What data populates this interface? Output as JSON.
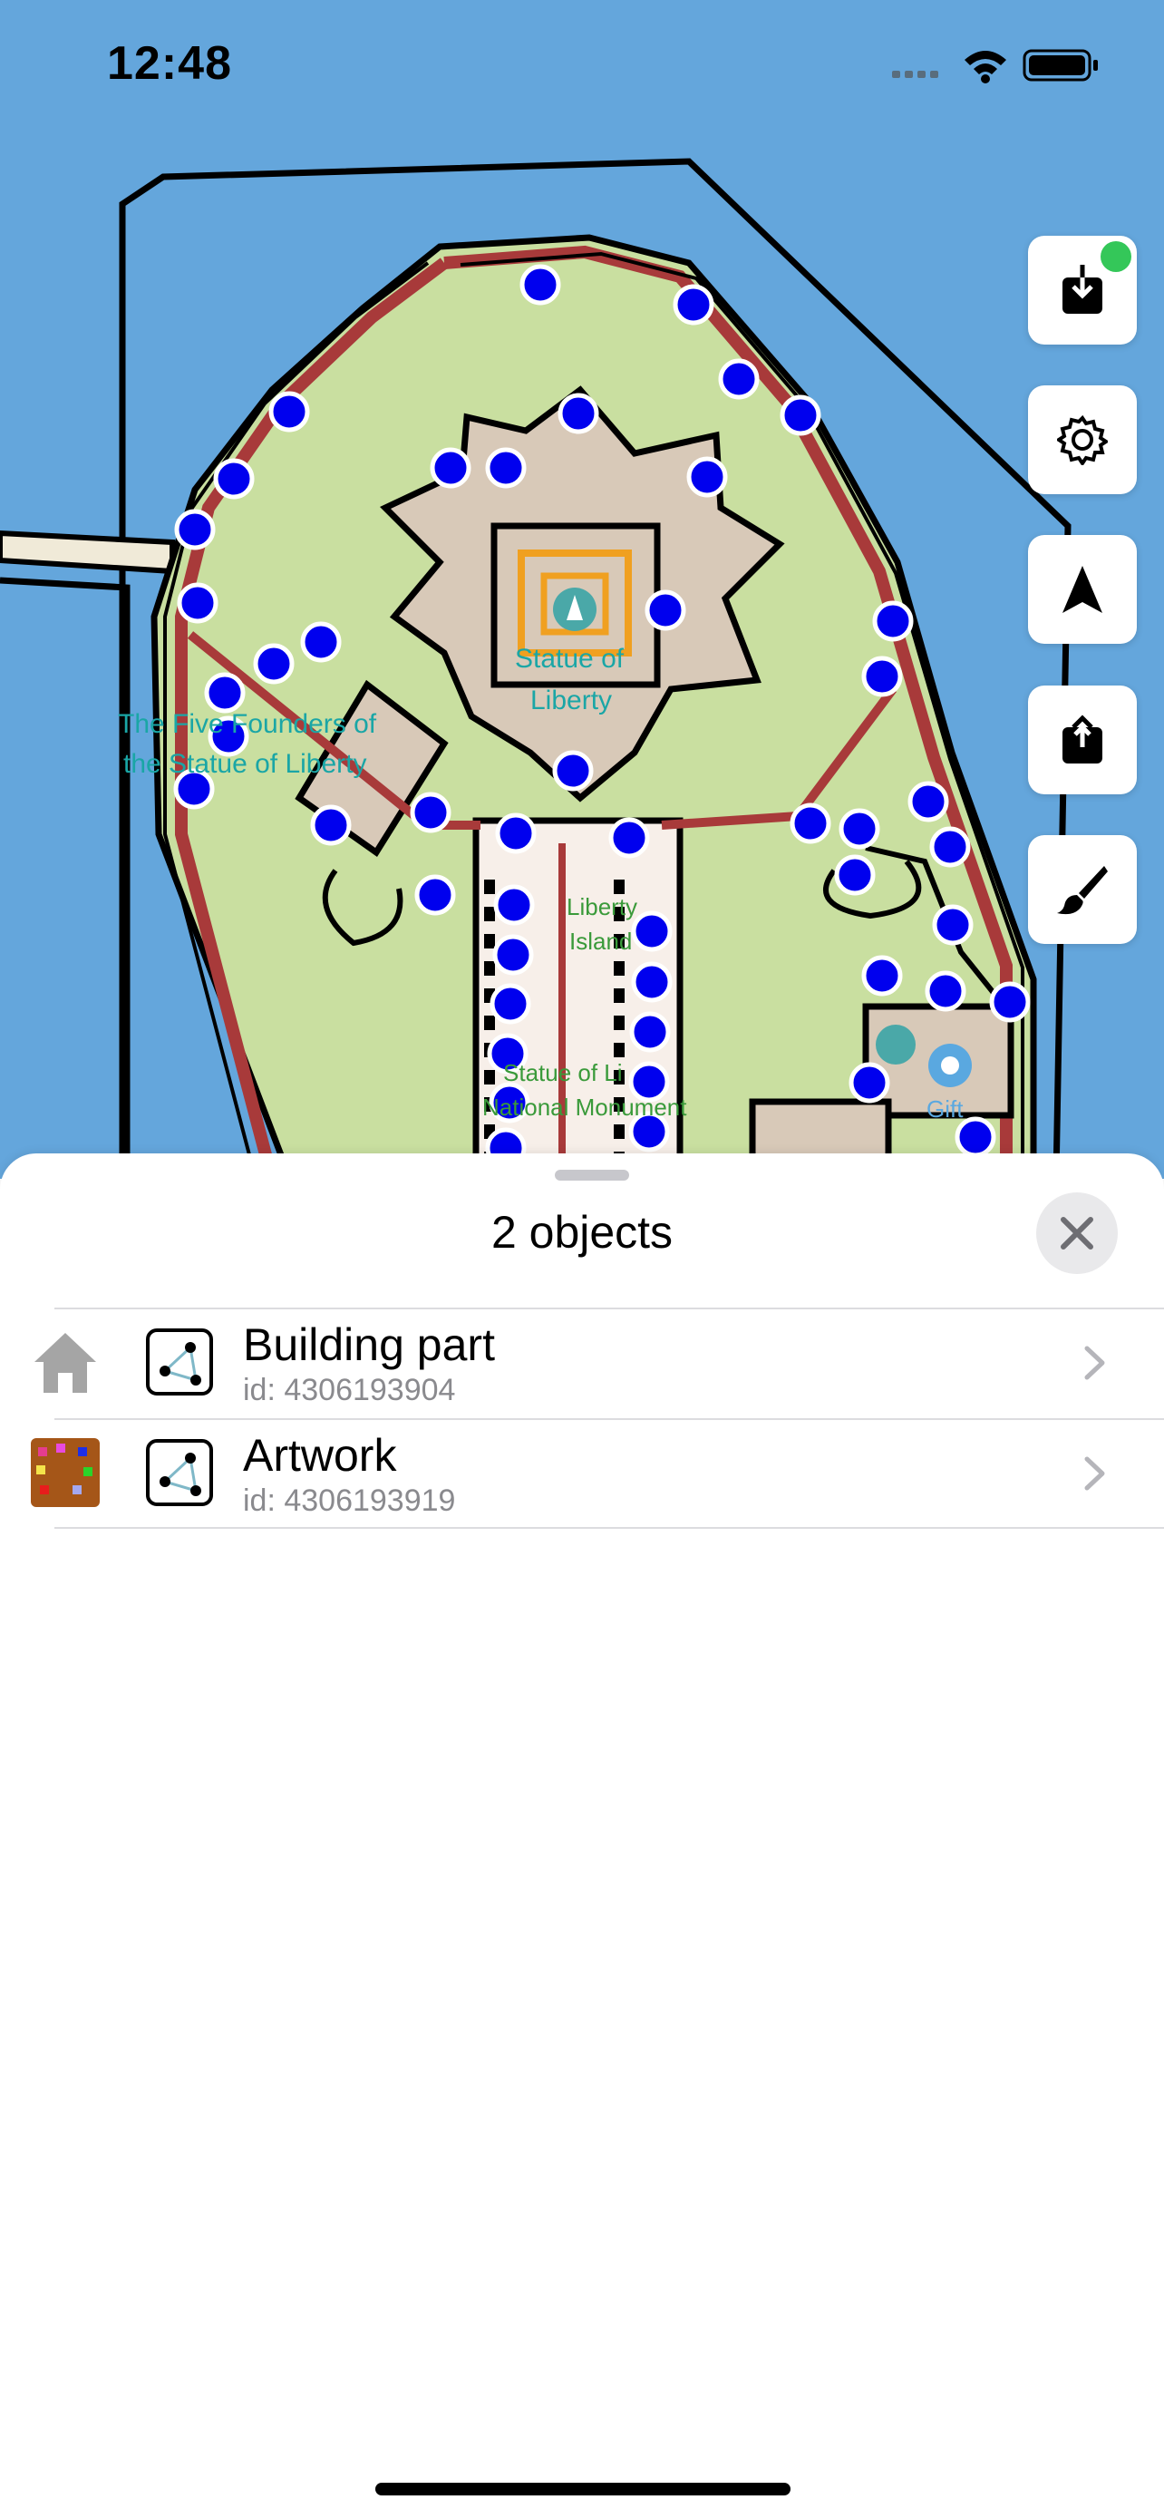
{
  "status_bar": {
    "time": "12:48",
    "icons": [
      "cellular-icon",
      "wifi-icon",
      "battery-icon"
    ]
  },
  "map": {
    "labels": [
      {
        "text": "Statue of"
      },
      {
        "text": "Liberty"
      },
      {
        "text": "The Five Founders of"
      },
      {
        "text": "the Statue of Liberty"
      },
      {
        "text": "Liberty"
      },
      {
        "text": "Island"
      },
      {
        "text": "Statue of Li"
      },
      {
        "text": "National Monument"
      },
      {
        "text": "Gift"
      }
    ],
    "colors": {
      "water": "#64a6dc",
      "grass": "#c9dfa0",
      "pavement": "#d8c9b8",
      "road_red": "#a83a3a",
      "node_blue": "#0000ee",
      "label_teal": "#1aa6a6",
      "label_green": "#3a9a3a"
    }
  },
  "toolbar": {
    "buttons": [
      {
        "name": "download-button",
        "icon": "download-icon",
        "has_badge": true
      },
      {
        "name": "settings-button",
        "icon": "gear-icon"
      },
      {
        "name": "location-button",
        "icon": "location-arrow-icon"
      },
      {
        "name": "upload-button",
        "icon": "upload-icon"
      },
      {
        "name": "paint-button",
        "icon": "brush-icon"
      }
    ],
    "badge_color": "#34c759"
  },
  "sheet": {
    "title": "2 objects",
    "close_icon": "close-icon",
    "items": [
      {
        "title": "Building part",
        "subtitle": "id: 4306193904",
        "icon": "house-icon",
        "geometry_icon": "polygon-icon"
      },
      {
        "title": "Artwork",
        "subtitle": "id: 4306193919",
        "icon": "artwork-icon",
        "geometry_icon": "polygon-icon"
      }
    ]
  }
}
